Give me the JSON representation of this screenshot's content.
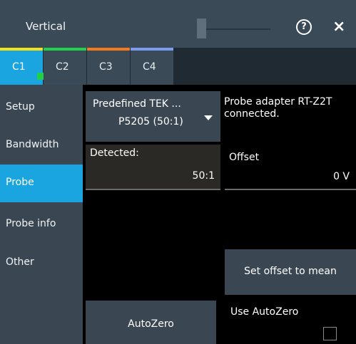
{
  "titlebar": {
    "title": "Vertical",
    "help_icon": "?",
    "close_icon": "×"
  },
  "tabs": [
    {
      "label": "C1",
      "color": "#f5e11a",
      "active": true
    },
    {
      "label": "C2",
      "color": "#21d04a",
      "active": false
    },
    {
      "label": "C3",
      "color": "#f57a1f",
      "active": false
    },
    {
      "label": "C4",
      "color": "#7b9cf0",
      "active": false
    }
  ],
  "sidebar": {
    "items": [
      {
        "label": "Setup"
      },
      {
        "label": "Bandwidth"
      },
      {
        "label": "Probe",
        "active": true
      },
      {
        "label": "Probe info"
      },
      {
        "label": "Other"
      }
    ]
  },
  "main": {
    "probe_select": {
      "line1": "Predefined TEK ...",
      "line2": "P5205 (50:1)"
    },
    "adapter_status": "Probe adapter RT-Z2T connected.",
    "detected": {
      "label": "Detected:",
      "value": "50:1"
    },
    "offset": {
      "label": "Offset",
      "value": "0 V"
    },
    "set_offset_button": "Set offset to mean",
    "autozero_button": "AutoZero",
    "use_autozero": {
      "label": "Use AutoZero",
      "checked": false
    }
  },
  "colors": {
    "accent": "#1aa4e0",
    "titlebar": "#3b4a57",
    "panel": "#3a4753"
  }
}
